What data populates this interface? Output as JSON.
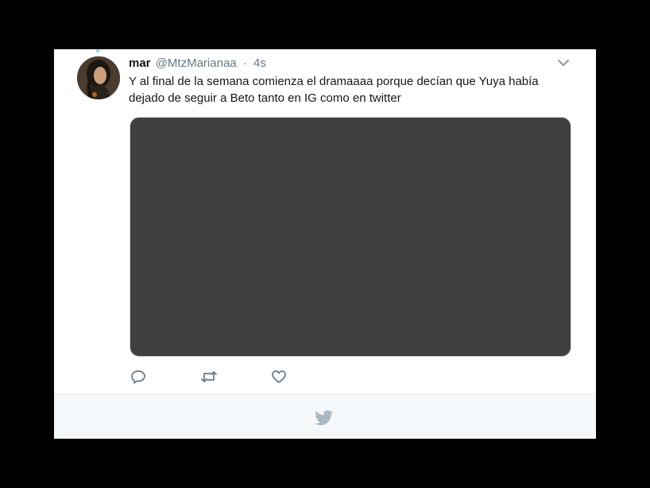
{
  "tweet": {
    "display_name": "mar",
    "handle": "@MtzMarianaa",
    "separator": "·",
    "timestamp": "4s",
    "text_lines": [
      "Y al final de la semana comienza el dramaaaa porque decían que Yuya había",
      "dejado de seguir a Beto tanto en IG como en twitter"
    ],
    "media_color": "#404040"
  },
  "actions": {
    "icons": [
      "reply-icon",
      "retweet-icon",
      "like-icon"
    ]
  },
  "footer": {
    "icon": "twitter-bird-icon"
  },
  "colors": {
    "text": "#14171a",
    "secondary": "#657786",
    "footer_bg": "#f5f8fa",
    "bird": "#aab8c2"
  }
}
